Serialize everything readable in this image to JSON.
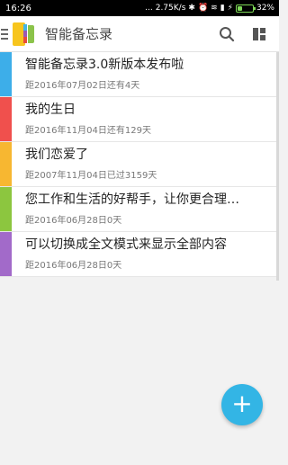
{
  "status_bar": {
    "time": "16:26",
    "signal_dots": "...",
    "speed": "2.75K/s",
    "battery": "32%",
    "battery_level": 0.32
  },
  "app_bar": {
    "title": "智能备忘录"
  },
  "memos": [
    {
      "title": "智能备忘录3.0新版本发布啦",
      "subtitle": "距2016年07月02日还有4天",
      "color": "#3daee9"
    },
    {
      "title": "我的生日",
      "subtitle": "距2016年11月04日还有129天",
      "color": "#f0504d"
    },
    {
      "title": "我们恋爱了",
      "subtitle": "距2007年11月04日已过3159天",
      "color": "#f7b731"
    },
    {
      "title": "您工作和生活的好帮手，让你更合理…",
      "subtitle": "距2016年06月28日0天",
      "color": "#8cc63f"
    },
    {
      "title": "可以切换成全文模式来显示全部内容",
      "subtitle": "距2016年06月28日0天",
      "color": "#a26ac9"
    }
  ],
  "fab": {
    "label": "+"
  }
}
